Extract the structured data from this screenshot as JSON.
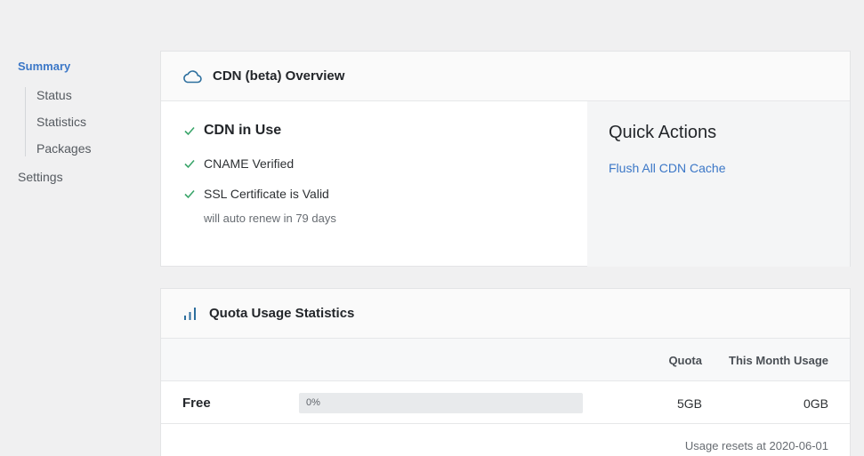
{
  "sidebar": {
    "summary": "Summary",
    "items": [
      "Status",
      "Statistics",
      "Packages"
    ],
    "settings": "Settings"
  },
  "overview": {
    "title": "CDN (beta) Overview",
    "icon": "cloud-icon",
    "checks": {
      "in_use": "CDN in Use",
      "cname": "CNAME Verified",
      "ssl": "SSL Certificate is Valid",
      "renew_note": "will auto renew in 79 days"
    },
    "quick_actions": {
      "title": "Quick Actions",
      "flush": "Flush All CDN Cache"
    }
  },
  "quota": {
    "title": "Quota Usage Statistics",
    "icon": "bar-chart-icon",
    "columns": {
      "quota": "Quota",
      "usage": "This Month Usage"
    },
    "rows": [
      {
        "plan": "Free",
        "percent_label": "0%",
        "percent": 0,
        "quota": "5GB",
        "usage": "0GB"
      }
    ],
    "reset_note": "Usage resets at 2020-06-01"
  },
  "colors": {
    "accent": "#3b77c7",
    "check": "#3aa56a",
    "icon": "#2d6f9e"
  }
}
